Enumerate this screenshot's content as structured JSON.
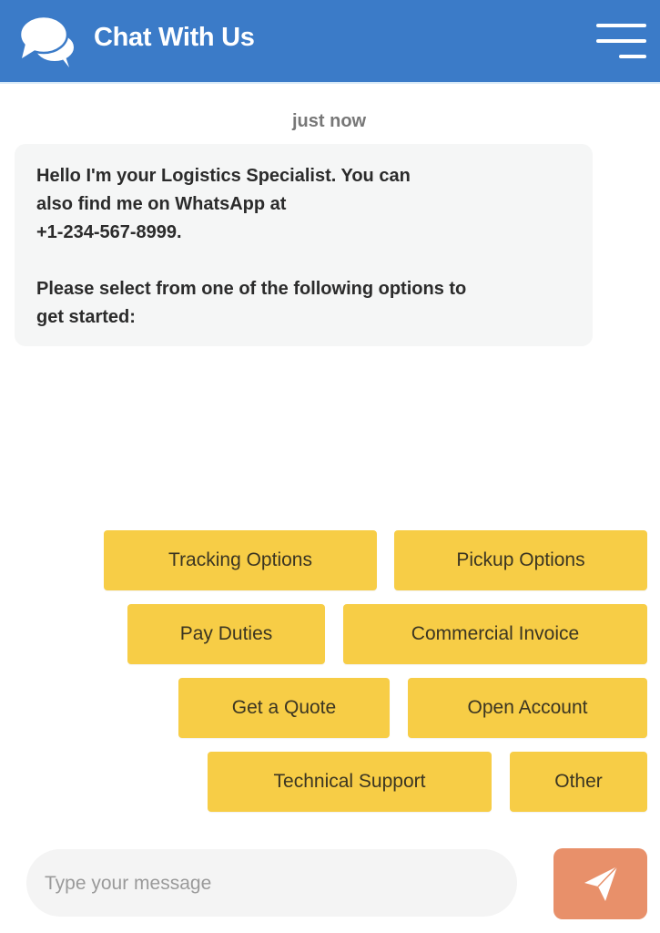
{
  "header": {
    "title": "Chat With Us",
    "icon": "chat-bubbles-icon",
    "menu_icon": "hamburger-menu-icon",
    "background_color": "#3b7bc8"
  },
  "conversation": {
    "timestamp": "just now",
    "message": {
      "line1": "Hello  I'm your Logistics Specialist. You can",
      "line2": "also find me on WhatsApp at",
      "line3": "+1-234-567-8999.",
      "line4": "Please select from one of the following options to",
      "line5": "get started:"
    }
  },
  "options": [
    {
      "label": "Tracking Options"
    },
    {
      "label": "Pickup Options"
    },
    {
      "label": "Pay Duties"
    },
    {
      "label": "Commercial Invoice"
    },
    {
      "label": "Get a Quote"
    },
    {
      "label": "Open Account"
    },
    {
      "label": "Technical Support"
    },
    {
      "label": "Other"
    }
  ],
  "option_color": "#f7cd46",
  "composer": {
    "placeholder": "Type your message",
    "value": "",
    "send_icon": "paper-plane-send-icon",
    "send_color": "#e8906a"
  }
}
